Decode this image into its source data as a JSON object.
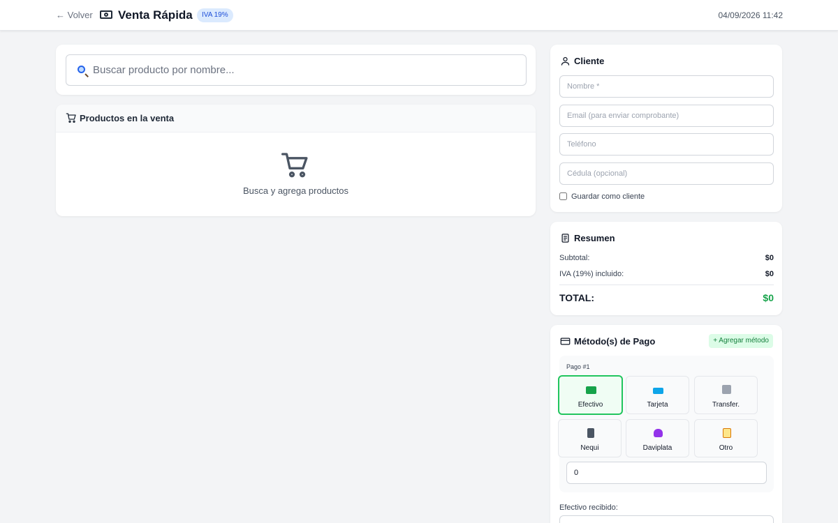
{
  "header": {
    "back_label": "← Volver",
    "title": "Venta Rápida",
    "badge": "IVA 19%",
    "datetime": "04/09/2026 11:42"
  },
  "search": {
    "placeholder": "Buscar producto por nombre..."
  },
  "products": {
    "title": "Productos en la venta",
    "empty_text": "Busca y agrega productos"
  },
  "cliente": {
    "title": "Cliente",
    "name_placeholder": "Nombre *",
    "email_placeholder": "Email (para enviar comprobante)",
    "phone_placeholder": "Teléfono",
    "id_placeholder": "Cédula (opcional)",
    "save_label": "Guardar como cliente"
  },
  "resumen": {
    "title": "Resumen",
    "subtotal_label": "Subtotal:",
    "subtotal_value": "$0",
    "iva_label": "IVA (19%) incluido:",
    "iva_value": "$0",
    "total_label": "TOTAL:",
    "total_value": "$0"
  },
  "pago": {
    "title": "Método(s) de Pago",
    "add_label": "+ Agregar método",
    "payment_label": "Pago #1",
    "amount_value": "0",
    "cash_received_label": "Efectivo recibido:",
    "methods": [
      {
        "label": "Efectivo",
        "icon": "cash-icon",
        "color": "#16a34a",
        "selected": true
      },
      {
        "label": "Tarjeta",
        "icon": "card-icon",
        "color": "#0ea5e9",
        "selected": false
      },
      {
        "label": "Transfer.",
        "icon": "bank-icon",
        "color": "#9ca3af",
        "selected": false
      },
      {
        "label": "Nequi",
        "icon": "phone-icon",
        "color": "#4b5563",
        "selected": false
      },
      {
        "label": "Daviplata",
        "icon": "purple-heart-icon",
        "color": "#9333ea",
        "selected": false
      },
      {
        "label": "Otro",
        "icon": "clipboard-icon",
        "color": "#d97706",
        "selected": false
      }
    ]
  },
  "colors": {
    "accent_green": "#16a34a",
    "badge_blue": "#1d4ed8",
    "selected_border": "#22c55e"
  }
}
